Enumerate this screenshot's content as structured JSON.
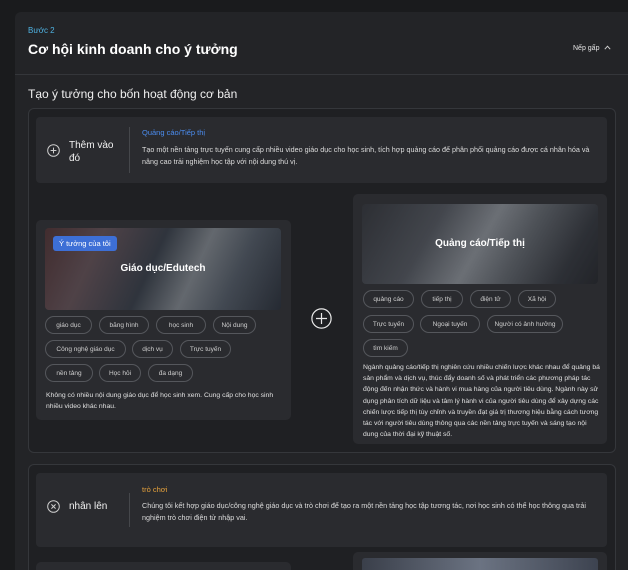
{
  "header": {
    "step_label": "Bước 2",
    "title": "Cơ hội kinh doanh cho ý tưởng",
    "collapse_label": "Nếp gấp"
  },
  "section": {
    "subtitle": "Tạo ý tưởng cho bốn hoạt động cơ bản"
  },
  "add_bar": {
    "action_label": "Thêm vào đó",
    "action_icon": "add-circle-icon",
    "tag": "Quảng cáo/Tiếp thị",
    "description": "Tạo một nền tảng trực tuyến cung cấp nhiều video giáo dục cho học sinh, tích hợp quảng cáo để phân phối quảng cáo được cá nhân hóa và nâng cao trải nghiệm học tập với nội dung thú vị."
  },
  "my_idea": {
    "badge": "Ý tưởng của tôi",
    "image_title": "Giáo dục/Edutech",
    "chips": [
      "giáo dục",
      "băng hình",
      "học sinh",
      "Nội dung",
      "Công nghệ giáo dục",
      "dịch vụ",
      "Trực tuyến",
      "nền tảng",
      "Học hỏi",
      "đa dạng"
    ],
    "description": "Không có nhiều nội dung giáo dục để học sinh xem. Cung cấp cho học sinh nhiều video khác nhau."
  },
  "combine": {
    "icon": "plus-circle-icon"
  },
  "partner_idea": {
    "image_title": "Quảng cáo/Tiếp thị",
    "chips": [
      "quảng cáo",
      "tiếp thị",
      "điện tử",
      "Xã hội",
      "Trực tuyến",
      "Ngoại tuyến",
      "Người có ảnh hưởng",
      "tìm kiếm"
    ],
    "description": "Ngành quảng cáo/tiếp thị nghiên cứu nhiều chiến lược khác nhau để quảng bá sản phẩm và dịch vụ, thúc đẩy doanh số và phát triển các phương pháp tác động đến nhận thức và hành vi mua hàng của người tiêu dùng. Ngành này sử dụng phân tích dữ liệu và tâm lý hành vi của người tiêu dùng để xây dựng các chiến lược tiếp thị tùy chỉnh và truyền đạt giá trị thương hiệu bằng cách tương tác với người tiêu dùng thông qua các nền tảng trực tuyến và sáng tạo nội dung của thời đại kỹ thuật số."
  },
  "raise_bar": {
    "action_label": "nhân lên",
    "action_icon": "multiply-circle-icon",
    "tag": "trò chơi",
    "description": "Chúng tôi kết hợp giáo dục/công nghệ giáo dục và trò chơi để tạo ra một nền tảng học tập tương tác, nơi học sinh có thể học thông qua trải nghiệm trò chơi điện tử nhập vai."
  },
  "colors": {
    "accent_blue": "#4b8df0",
    "step_blue": "#4fb3e3",
    "game_orange": "#e6a23c",
    "badge_blue": "#3d6fd6"
  }
}
